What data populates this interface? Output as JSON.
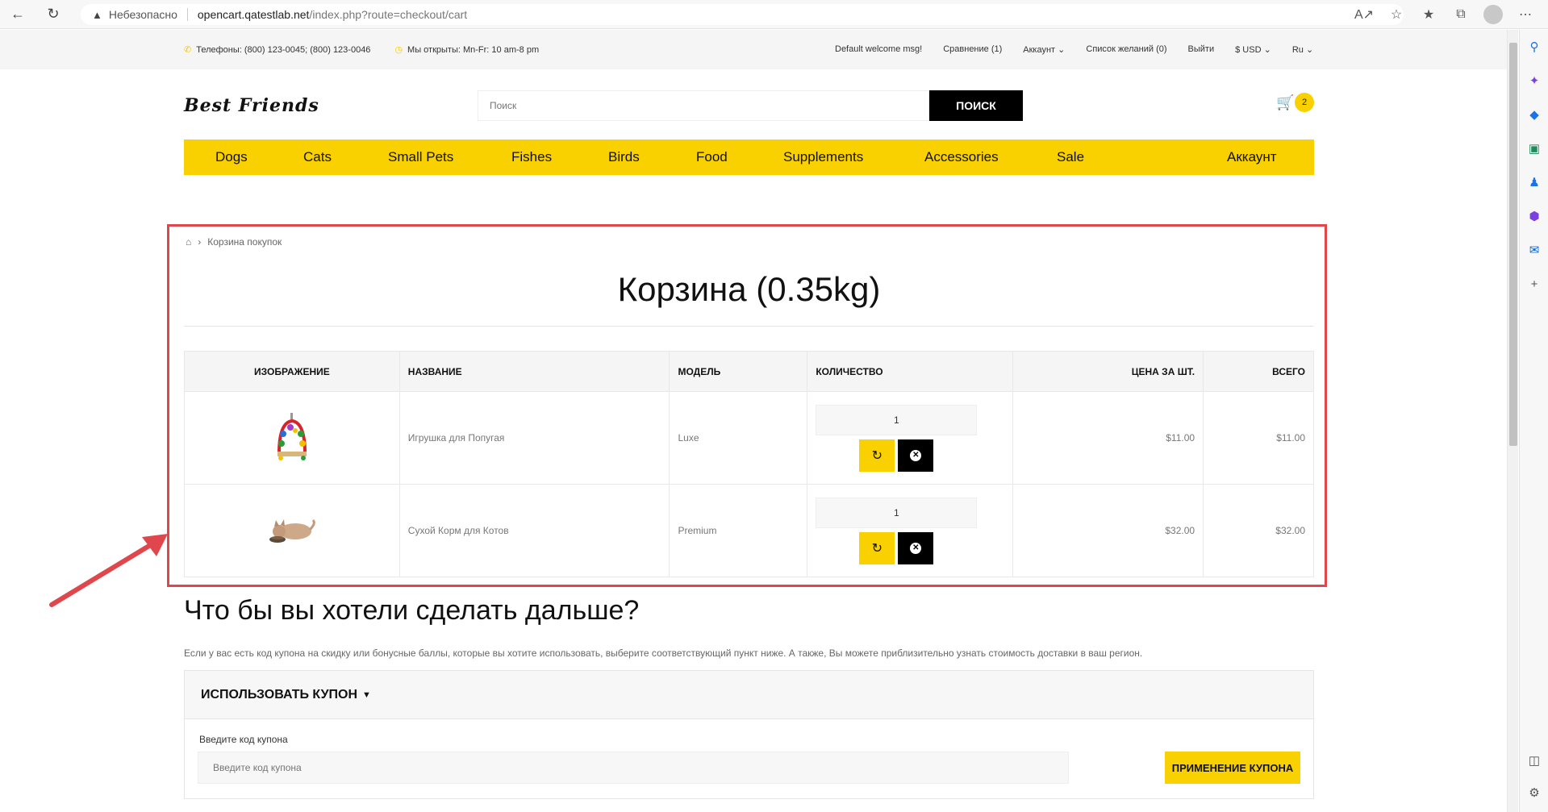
{
  "browser": {
    "insecure_label": "Небезопасно",
    "url_host": "opencart.qatestlab.net",
    "url_path": "/index.php?route=checkout/cart"
  },
  "topinfo": {
    "phones": "Телефоны: (800) 123-0045; (800) 123-0046",
    "hours": "Мы открыты: Mn-Fr: 10 am-8 pm",
    "welcome": "Default welcome msg!",
    "compare": "Сравнение (1)",
    "account": "Аккаунт",
    "wishlist": "Список желаний (0)",
    "logout": "Выйти",
    "currency": "$ USD",
    "language": "Ru"
  },
  "header": {
    "logo": "Best Friends",
    "search_placeholder": "Поиск",
    "search_button": "ПОИСК",
    "cart_count": "2"
  },
  "nav": {
    "items": [
      "Dogs",
      "Cats",
      "Small Pets",
      "Fishes",
      "Birds",
      "Food",
      "Supplements",
      "Accessories",
      "Sale"
    ],
    "account": "Аккаунт"
  },
  "breadcrumb": {
    "current": "Корзина покупок"
  },
  "page_title": "Корзина  (0.35kg)",
  "cart_table": {
    "headers": [
      "Изображение",
      "Название",
      "Модель",
      "Количество",
      "Цена за шт.",
      "Всего"
    ],
    "rows": [
      {
        "name": "Игрушка для Попугая",
        "model": "Luxe",
        "qty": "1",
        "price": "$11.00",
        "total": "$11.00"
      },
      {
        "name": "Сухой Корм для Котов",
        "model": "Premium",
        "qty": "1",
        "price": "$32.00",
        "total": "$32.00"
      }
    ]
  },
  "next_section": {
    "title": "Что бы вы хотели сделать дальше?",
    "description": "Если у вас есть код купона на скидку или бонусные баллы, которые вы хотите использовать, выберите соответствующий пункт ниже. А также, Вы можете приблизительно узнать стоимость доставки в ваш регион."
  },
  "coupon": {
    "heading": "ИСПОЛЬЗОВАТЬ КУПОН",
    "label": "Введите код купона",
    "placeholder": "Введите код купона",
    "button": "ПРИМЕНЕНИЕ КУПОНА"
  },
  "colors": {
    "accent": "#f9d000",
    "highlight_frame": "#e0474c"
  }
}
